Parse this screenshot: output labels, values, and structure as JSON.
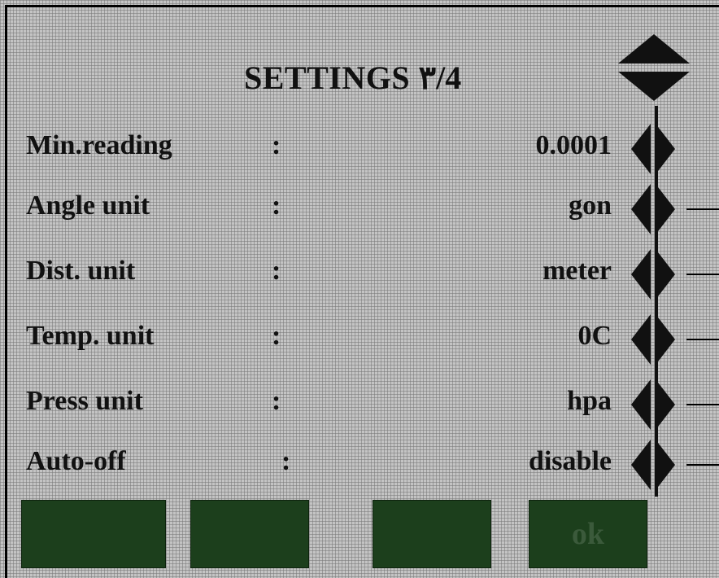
{
  "screen": {
    "title": "SETTINGS ٣/4"
  },
  "settings": [
    {
      "label": "Min.reading",
      "colon": ":",
      "value": "0.0001"
    },
    {
      "label": "Angle unit",
      "colon": ":",
      "value": "gon"
    },
    {
      "label": "Dist. unit",
      "colon": ":",
      "value": "meter"
    },
    {
      "label": "Temp. unit",
      "colon": ":",
      "value": "0C"
    },
    {
      "label": "Press unit",
      "colon": ":",
      "value": "hpa"
    },
    {
      "label": "Auto-off",
      "colon": ":",
      "value": "disable"
    }
  ],
  "softkeys": [
    "",
    "",
    "",
    "ok"
  ],
  "colors": {
    "background": "#c4c4c4",
    "softkey": "#1c3f1c",
    "softkey_text": "#3b5a3b",
    "text": "#111111"
  },
  "icons": {
    "scroll_up": "triangle-up-icon",
    "scroll_down": "triangle-down-icon",
    "value_stepper": "left-right-arrow-icon"
  }
}
